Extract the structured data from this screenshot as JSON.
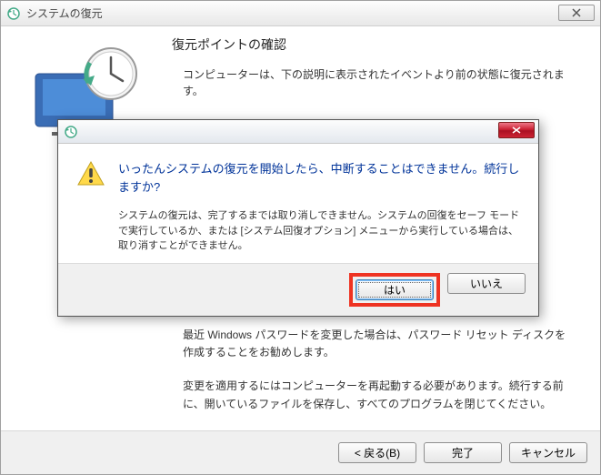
{
  "window": {
    "title": "システムの復元"
  },
  "main": {
    "heading": "復元ポイントの確認",
    "subtext": "コンピューターは、下の説明に表示されたイベントより前の状態に復元されます。",
    "password_note": "最近 Windows パスワードを変更した場合は、パスワード リセット ディスクを作成することをお勧めします。",
    "restart_note": "変更を適用するにはコンピューターを再起動する必要があります。続行する前に、開いているファイルを保存し、すべてのプログラムを閉じてください。"
  },
  "footer": {
    "back": "< 戻る(B)",
    "finish": "完了",
    "cancel": "キャンセル"
  },
  "modal": {
    "main_text": "いったんシステムの復元を開始したら、中断することはできません。続行しますか?",
    "detail": "システムの復元は、完了するまでは取り消しできません。システムの回復をセーフ モードで実行しているか、または [システム回復オプション] メニューから実行している場合は、取り消すことができません。",
    "yes": "はい",
    "no": "いいえ"
  }
}
